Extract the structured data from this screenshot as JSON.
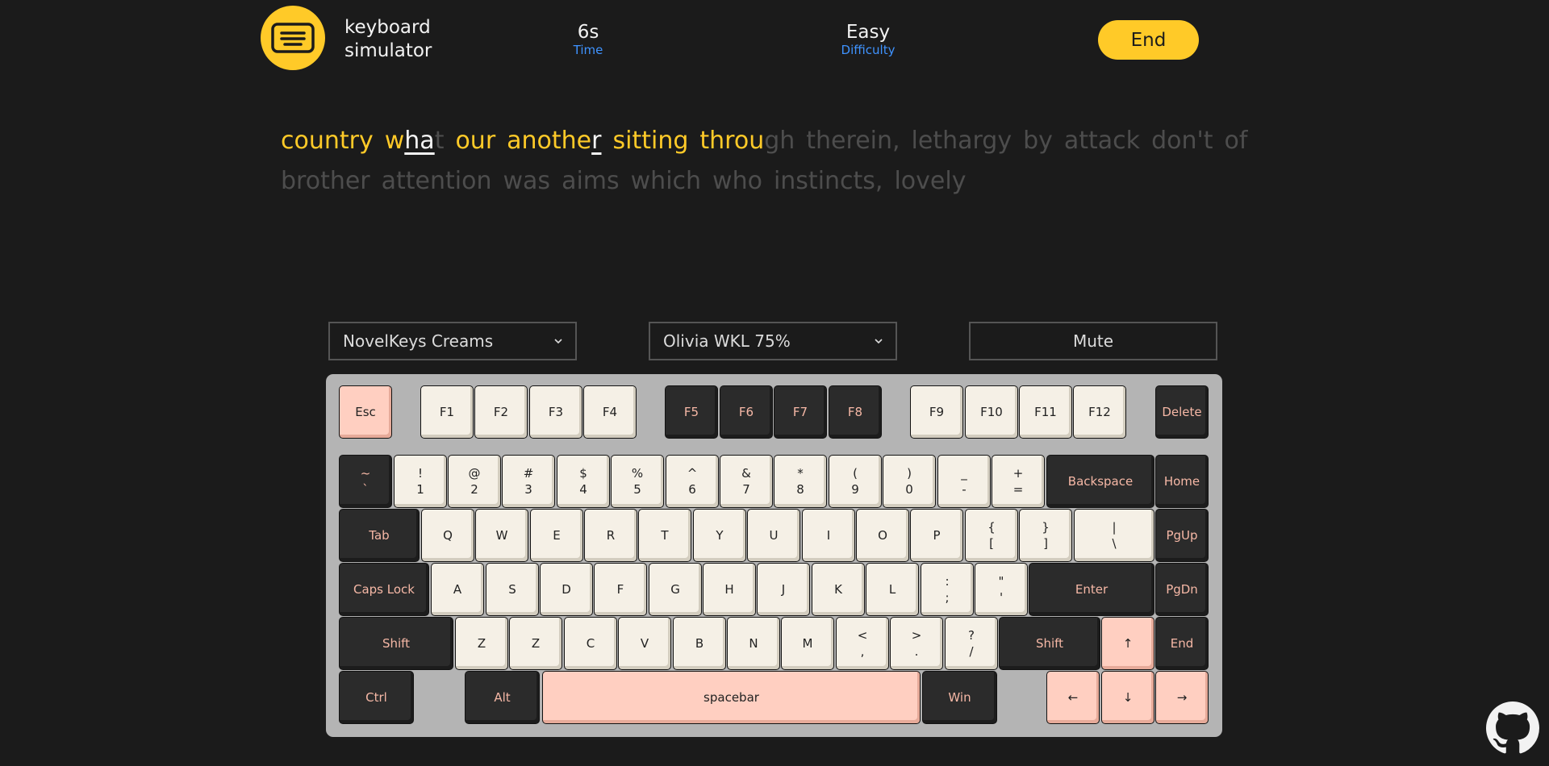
{
  "brand": {
    "line1": "keyboard",
    "line2": "simulator"
  },
  "stats": {
    "time_value": "6s",
    "time_label": "Time",
    "difficulty_value": "Easy",
    "difficulty_label": "Difficulty"
  },
  "end_label": "End",
  "passage": {
    "words": [
      {
        "done": "country",
        "cur": "",
        "rest": ""
      },
      {
        "done": "w",
        "cur": "ha",
        "rest": "t"
      },
      {
        "done": "our",
        "cur": "",
        "rest": ""
      },
      {
        "done": "anothe",
        "cur": "r",
        "rest": ""
      },
      {
        "done": "sitting",
        "cur": "",
        "rest": ""
      },
      {
        "done": "throu",
        "cur": "",
        "rest": "gh"
      },
      {
        "done": "",
        "cur": "",
        "rest": "therein,"
      },
      {
        "done": "",
        "cur": "",
        "rest": "lethargy"
      },
      {
        "done": "",
        "cur": "",
        "rest": "by"
      },
      {
        "done": "",
        "cur": "",
        "rest": "attack"
      },
      {
        "done": "",
        "cur": "",
        "rest": "don't"
      },
      {
        "done": "",
        "cur": "",
        "rest": "of"
      },
      {
        "done": "",
        "cur": "",
        "rest": "brother"
      },
      {
        "done": "",
        "cur": "",
        "rest": "attention"
      },
      {
        "done": "",
        "cur": "",
        "rest": "was"
      },
      {
        "done": "",
        "cur": "",
        "rest": "aims"
      },
      {
        "done": "",
        "cur": "",
        "rest": "which"
      },
      {
        "done": "",
        "cur": "",
        "rest": "who"
      },
      {
        "done": "",
        "cur": "",
        "rest": "instincts,"
      },
      {
        "done": "",
        "cur": "",
        "rest": "lovely"
      }
    ]
  },
  "controls": {
    "switch_select": "NovelKeys Creams",
    "keyboard_select": "Olivia WKL 75%",
    "mute_label": "Mute"
  },
  "keyboard": {
    "rows": [
      [
        [
          "Esc",
          "",
          "pink"
        ],
        [
          "F1",
          "",
          "cream"
        ],
        [
          "F2",
          "",
          "cream"
        ],
        [
          "F3",
          "",
          "cream"
        ],
        [
          "F4",
          "",
          "cream"
        ],
        [
          "F5",
          "",
          "dark"
        ],
        [
          "F6",
          "",
          "dark"
        ],
        [
          "F7",
          "",
          "dark"
        ],
        [
          "F8",
          "",
          "dark"
        ],
        [
          "F9",
          "",
          "cream"
        ],
        [
          "F10",
          "",
          "cream"
        ],
        [
          "F11",
          "",
          "cream"
        ],
        [
          "F12",
          "",
          "cream"
        ],
        [
          "Delete",
          "",
          "dark"
        ]
      ],
      [
        [
          "~",
          "`",
          "dark"
        ],
        [
          "!",
          "1",
          "cream"
        ],
        [
          "@",
          "2",
          "cream"
        ],
        [
          "#",
          "3",
          "cream"
        ],
        [
          "$",
          "4",
          "cream"
        ],
        [
          "%",
          "5",
          "cream"
        ],
        [
          "^",
          "6",
          "cream"
        ],
        [
          "&",
          "7",
          "cream"
        ],
        [
          "*",
          "8",
          "cream"
        ],
        [
          "(",
          "9",
          "cream"
        ],
        [
          ")",
          "0",
          "cream"
        ],
        [
          "_",
          "-",
          "cream"
        ],
        [
          "+",
          "=",
          "cream"
        ],
        [
          "Backspace",
          "",
          "dark"
        ],
        [
          "Home",
          "",
          "dark"
        ]
      ],
      [
        [
          "Tab",
          "",
          "dark"
        ],
        [
          "Q",
          "",
          "cream"
        ],
        [
          "W",
          "",
          "cream"
        ],
        [
          "E",
          "",
          "cream"
        ],
        [
          "R",
          "",
          "cream"
        ],
        [
          "T",
          "",
          "cream"
        ],
        [
          "Y",
          "",
          "cream"
        ],
        [
          "U",
          "",
          "cream"
        ],
        [
          "I",
          "",
          "cream"
        ],
        [
          "O",
          "",
          "cream"
        ],
        [
          "P",
          "",
          "cream"
        ],
        [
          "{",
          "[",
          "cream"
        ],
        [
          "}",
          "]",
          "cream"
        ],
        [
          "|",
          "\\",
          "cream"
        ],
        [
          "PgUp",
          "",
          "dark"
        ]
      ],
      [
        [
          "Caps Lock",
          "",
          "dark"
        ],
        [
          "A",
          "",
          "cream"
        ],
        [
          "S",
          "",
          "cream"
        ],
        [
          "D",
          "",
          "cream"
        ],
        [
          "F",
          "",
          "cream"
        ],
        [
          "G",
          "",
          "cream"
        ],
        [
          "H",
          "",
          "cream"
        ],
        [
          "J",
          "",
          "cream"
        ],
        [
          "K",
          "",
          "cream"
        ],
        [
          "L",
          "",
          "cream"
        ],
        [
          ":",
          ";",
          "cream"
        ],
        [
          "\"",
          "'",
          "cream"
        ],
        [
          "Enter",
          "",
          "dark"
        ],
        [
          "PgDn",
          "",
          "dark"
        ]
      ],
      [
        [
          "Shift",
          "",
          "dark"
        ],
        [
          "Z",
          "",
          "cream"
        ],
        [
          "Z",
          "",
          "cream"
        ],
        [
          "C",
          "",
          "cream"
        ],
        [
          "V",
          "",
          "cream"
        ],
        [
          "B",
          "",
          "cream"
        ],
        [
          "N",
          "",
          "cream"
        ],
        [
          "M",
          "",
          "cream"
        ],
        [
          "<",
          ",",
          "cream"
        ],
        [
          ">",
          ".",
          "cream"
        ],
        [
          "?",
          "/",
          "cream"
        ],
        [
          "Shift",
          "",
          "dark"
        ],
        [
          "↑",
          "",
          "pink"
        ],
        [
          "End",
          "",
          "dark"
        ]
      ],
      [
        [
          "Ctrl",
          "",
          "dark"
        ],
        [
          "Alt",
          "",
          "dark"
        ],
        [
          "spacebar",
          "",
          "pink"
        ],
        [
          "Win",
          "",
          "dark"
        ],
        [
          "←",
          "",
          "pink"
        ],
        [
          "↓",
          "",
          "pink"
        ],
        [
          "→",
          "",
          "pink"
        ]
      ]
    ]
  },
  "icons": {
    "logo": "keyboard-icon",
    "github": "github-icon",
    "chevron": "chevron-down-icon"
  },
  "colors": {
    "accent": "#ffca28",
    "label_blue": "#3f93ff",
    "typed": "#ffca28",
    "pending": "#4d4d4d",
    "key_cream": "#f5f0e6",
    "key_dark": "#2b2b2b",
    "key_pink": "#ffcfc1"
  }
}
